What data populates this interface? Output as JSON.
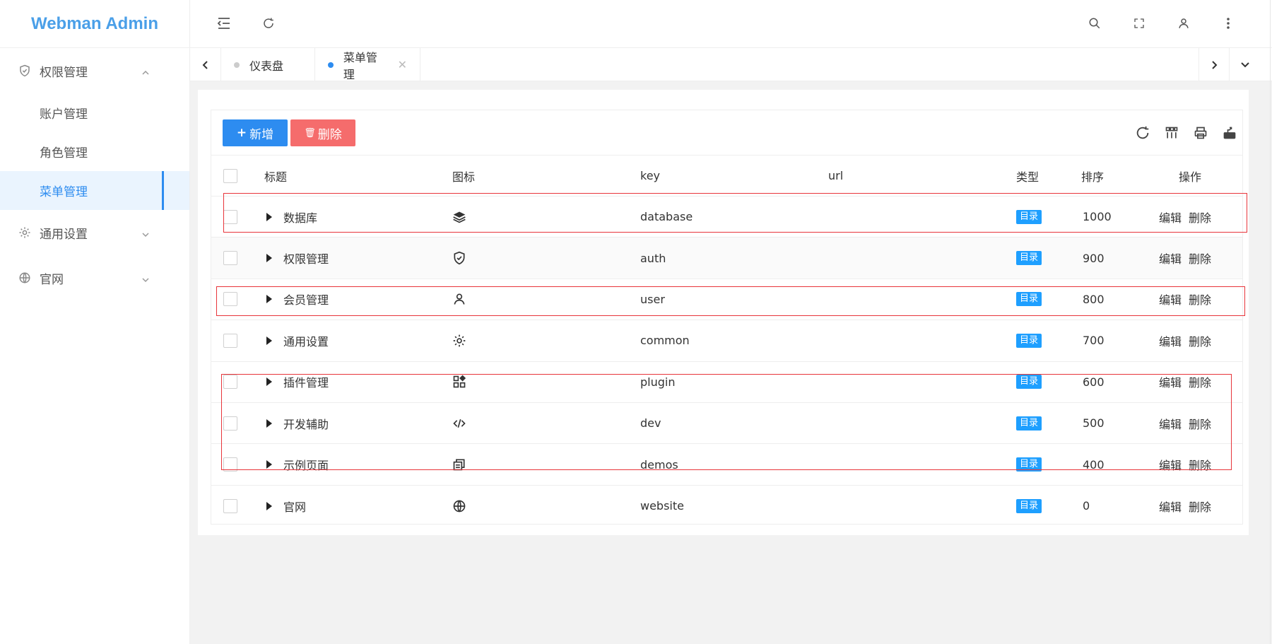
{
  "app": {
    "title": "Webman Admin"
  },
  "sidebar": {
    "groups": [
      {
        "label": "权限管理",
        "icon": "shield-check-icon",
        "expanded": true,
        "items": [
          {
            "label": "账户管理"
          },
          {
            "label": "角色管理"
          },
          {
            "label": "菜单管理",
            "active": true
          }
        ]
      },
      {
        "label": "通用设置",
        "icon": "gear-icon",
        "expanded": false
      },
      {
        "label": "官网",
        "icon": "globe-icon",
        "expanded": false
      }
    ]
  },
  "header": {
    "left_icons": [
      "collapse-menu-icon",
      "refresh-icon"
    ],
    "right_icons": [
      "search-icon",
      "fullscreen-icon",
      "user-icon",
      "more-vertical-icon"
    ]
  },
  "tabs": [
    {
      "label": "仪表盘",
      "active": false
    },
    {
      "label": "菜单管理",
      "active": true,
      "closable": true
    }
  ],
  "toolbar": {
    "add_label": "新增",
    "delete_label": "删除",
    "icons": [
      "refresh-icon",
      "columns-icon",
      "print-icon",
      "export-icon"
    ]
  },
  "table": {
    "columns": [
      "标题",
      "图标",
      "key",
      "url",
      "类型",
      "排序",
      "操作"
    ],
    "rows": [
      {
        "title": "数据库",
        "icon": "layers-icon",
        "key": "database",
        "url": "",
        "type": "目录",
        "sort": "1000"
      },
      {
        "title": "权限管理",
        "icon": "shield-check-icon",
        "key": "auth",
        "url": "",
        "type": "目录",
        "sort": "900"
      },
      {
        "title": "会员管理",
        "icon": "user-icon",
        "key": "user",
        "url": "",
        "type": "目录",
        "sort": "800"
      },
      {
        "title": "通用设置",
        "icon": "gear-icon",
        "key": "common",
        "url": "",
        "type": "目录",
        "sort": "700"
      },
      {
        "title": "插件管理",
        "icon": "apps-icon",
        "key": "plugin",
        "url": "",
        "type": "目录",
        "sort": "600"
      },
      {
        "title": "开发辅助",
        "icon": "code-icon",
        "key": "dev",
        "url": "",
        "type": "目录",
        "sort": "500"
      },
      {
        "title": "示例页面",
        "icon": "pages-icon",
        "key": "demos",
        "url": "",
        "type": "目录",
        "sort": "400"
      },
      {
        "title": "官网",
        "icon": "globe-icon",
        "key": "website",
        "url": "",
        "type": "目录",
        "sort": "0"
      }
    ],
    "actions": {
      "edit": "编辑",
      "delete": "删除"
    }
  },
  "colors": {
    "brand": "#4a9fe8",
    "primary": "#2d8cf0",
    "danger": "#f56c6c",
    "badge": "#1e9fff",
    "highlight_box": "#e8343a"
  }
}
